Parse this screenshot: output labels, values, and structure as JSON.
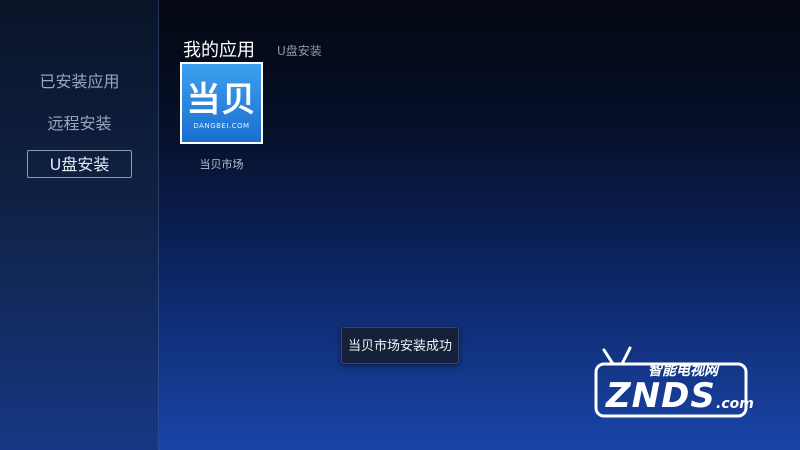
{
  "sidebar": {
    "items": [
      {
        "label": "已安装应用",
        "selected": false
      },
      {
        "label": "远程安装",
        "selected": false
      },
      {
        "label": "U盘安装",
        "selected": true
      }
    ]
  },
  "header": {
    "title": "我的应用",
    "subtitle": "U盘安装"
  },
  "apps": [
    {
      "name": "当贝市场",
      "logo_text": "当贝",
      "logo_domain": "DANGBEI.COM",
      "icon": "dangbei-app-icon"
    }
  ],
  "toast": {
    "message": "当贝市场安装成功"
  },
  "watermark": {
    "tagline": "智能电视网",
    "brand": "ZNDS",
    "domain": ".com"
  },
  "colors": {
    "tile_blue": "#2a8ce8",
    "toast_bg": "#15213a",
    "selected_border": "#8d99b1"
  }
}
